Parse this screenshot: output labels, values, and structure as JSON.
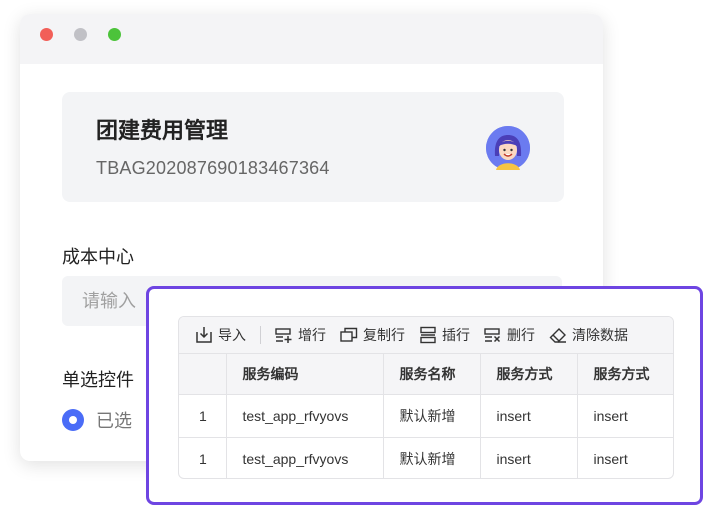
{
  "card": {
    "title": "团建费用管理",
    "code": "TBAG20208769018346736​4"
  },
  "form": {
    "cost_center_label": "成本中心",
    "cost_center_placeholder": "请输入",
    "radio_label": "单选控件",
    "radio_option": "已选"
  },
  "toolbar": {
    "import": "导入",
    "add_row": "增行",
    "copy_row": "复制行",
    "insert_row": "插行",
    "delete_row": "删行",
    "clear_data": "清除数据"
  },
  "table": {
    "headers": [
      "",
      "服务编码",
      "服务名称",
      "服务方式",
      "服务方式"
    ],
    "rows": [
      [
        "1",
        "test_app_rfvyovs",
        "默认新增",
        "insert",
        "insert"
      ],
      [
        "1",
        "test_app_rfvyovs",
        "默认新增",
        "insert",
        "insert"
      ]
    ]
  },
  "colors": {
    "accent": "#4a6cf7",
    "panel_border": "#6e45e2",
    "close": "#f25f58",
    "maximize": "#4cc33a"
  }
}
